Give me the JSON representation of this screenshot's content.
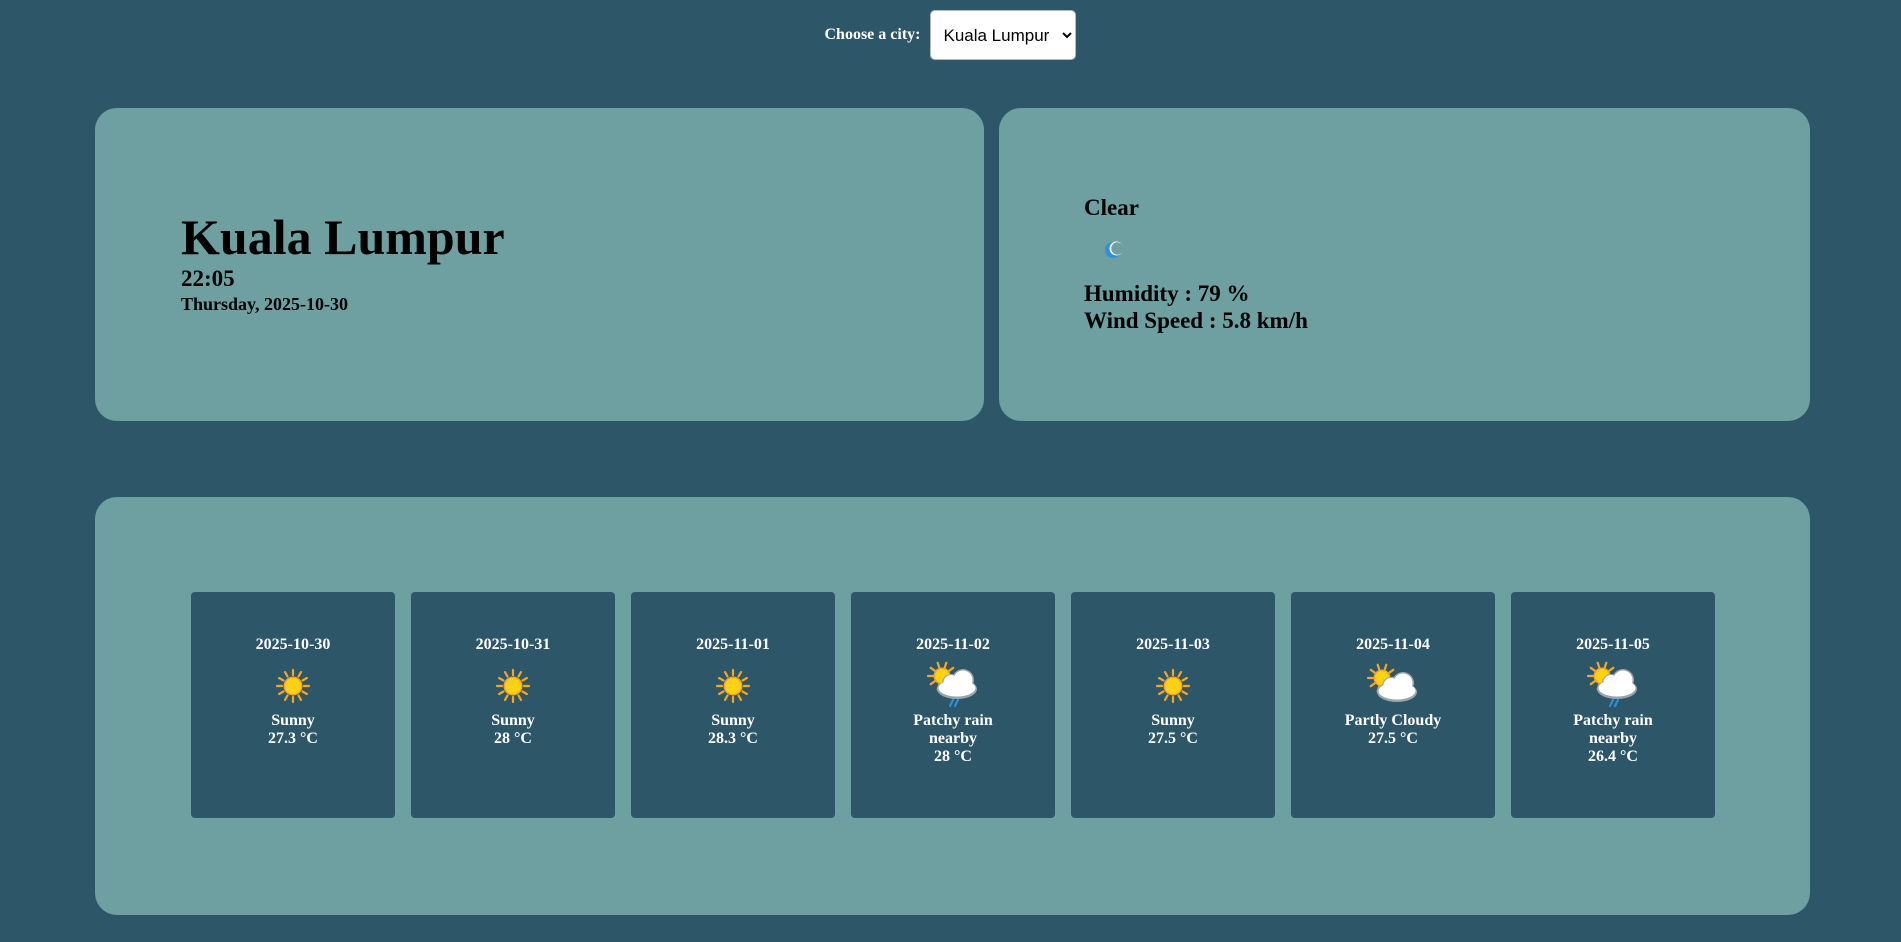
{
  "city_picker": {
    "label": "Choose a city:",
    "selected": "Kuala Lumpur"
  },
  "location": {
    "city": "Kuala Lumpur",
    "time": "22:05",
    "date": "Thursday, 2025-10-30"
  },
  "current": {
    "condition": "Clear",
    "icon": "crescent-moon-icon",
    "humidity": "Humidity : 79 %",
    "wind": "Wind Speed : 5.8 km/h"
  },
  "forecast": [
    {
      "date": "2025-10-30",
      "condition": "Sunny",
      "temp": "27.3 °C",
      "icon": "sunny"
    },
    {
      "date": "2025-10-31",
      "condition": "Sunny",
      "temp": "28 °C",
      "icon": "sunny"
    },
    {
      "date": "2025-11-01",
      "condition": "Sunny",
      "temp": "28.3 °C",
      "icon": "sunny"
    },
    {
      "date": "2025-11-02",
      "condition": "Patchy rain nearby",
      "temp": "28 °C",
      "icon": "patchy-rain"
    },
    {
      "date": "2025-11-03",
      "condition": "Sunny",
      "temp": "27.5 °C",
      "icon": "sunny"
    },
    {
      "date": "2025-11-04",
      "condition": "Partly Cloudy",
      "temp": "27.5 °C",
      "icon": "partly-cloudy"
    },
    {
      "date": "2025-11-05",
      "condition": "Patchy rain nearby",
      "temp": "26.4 °C",
      "icon": "patchy-rain"
    }
  ],
  "colors": {
    "background": "#2e5669",
    "panel": "#6e9fa1",
    "card": "#2e5669",
    "sun": "#fcd116",
    "sun_ray": "#f5a623",
    "cloud": "#ffffff",
    "rain": "#2d8fe0"
  }
}
